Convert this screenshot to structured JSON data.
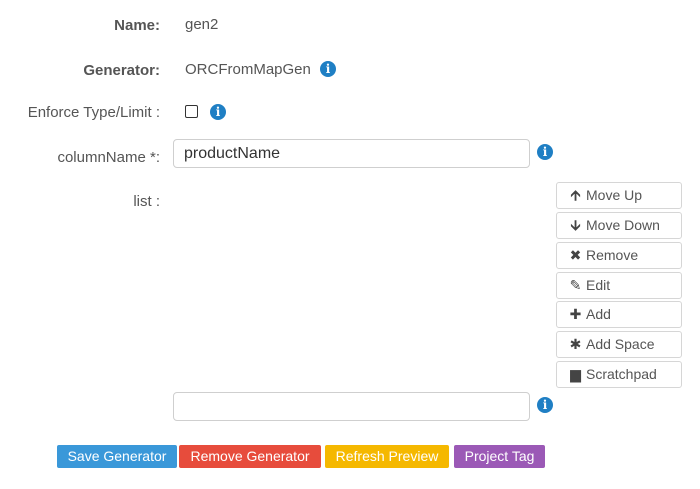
{
  "form": {
    "name_label": "Name:",
    "name_value": "gen2",
    "generator_label": "Generator:",
    "generator_value": "ORCFromMapGen",
    "enforce_label": "Enforce Type/Limit :",
    "enforce_checked": false,
    "column_label": "columnName *:",
    "column_value": "productName",
    "list_label": "list :",
    "list_input_value": "",
    "info_glyph": "i"
  },
  "list_buttons": [
    {
      "label": "Move Up",
      "icon": "arrow-up-icon",
      "glyph": "🡩"
    },
    {
      "label": "Move Down",
      "icon": "arrow-down-icon",
      "glyph": "🡫"
    },
    {
      "label": "Remove",
      "icon": "x-icon",
      "glyph": "✖"
    },
    {
      "label": "Edit",
      "icon": "pencil-icon",
      "glyph": "✎"
    },
    {
      "label": "Add",
      "icon": "plus-icon",
      "glyph": "✚"
    },
    {
      "label": "Add Space",
      "icon": "asterisk-icon",
      "glyph": "✱"
    },
    {
      "label": "Scratchpad",
      "icon": "file-icon",
      "glyph": "▆"
    }
  ],
  "actions": {
    "save": {
      "label": "Save Generator",
      "color": "#3a98d9"
    },
    "remove": {
      "label": "Remove Generator",
      "color": "#e74c3c"
    },
    "refresh": {
      "label": "Refresh Preview",
      "color": "#f5b800"
    },
    "tag": {
      "label": "Project Tag",
      "color": "#9b59b6"
    }
  },
  "colors": {
    "info": "#1f7fc4"
  }
}
